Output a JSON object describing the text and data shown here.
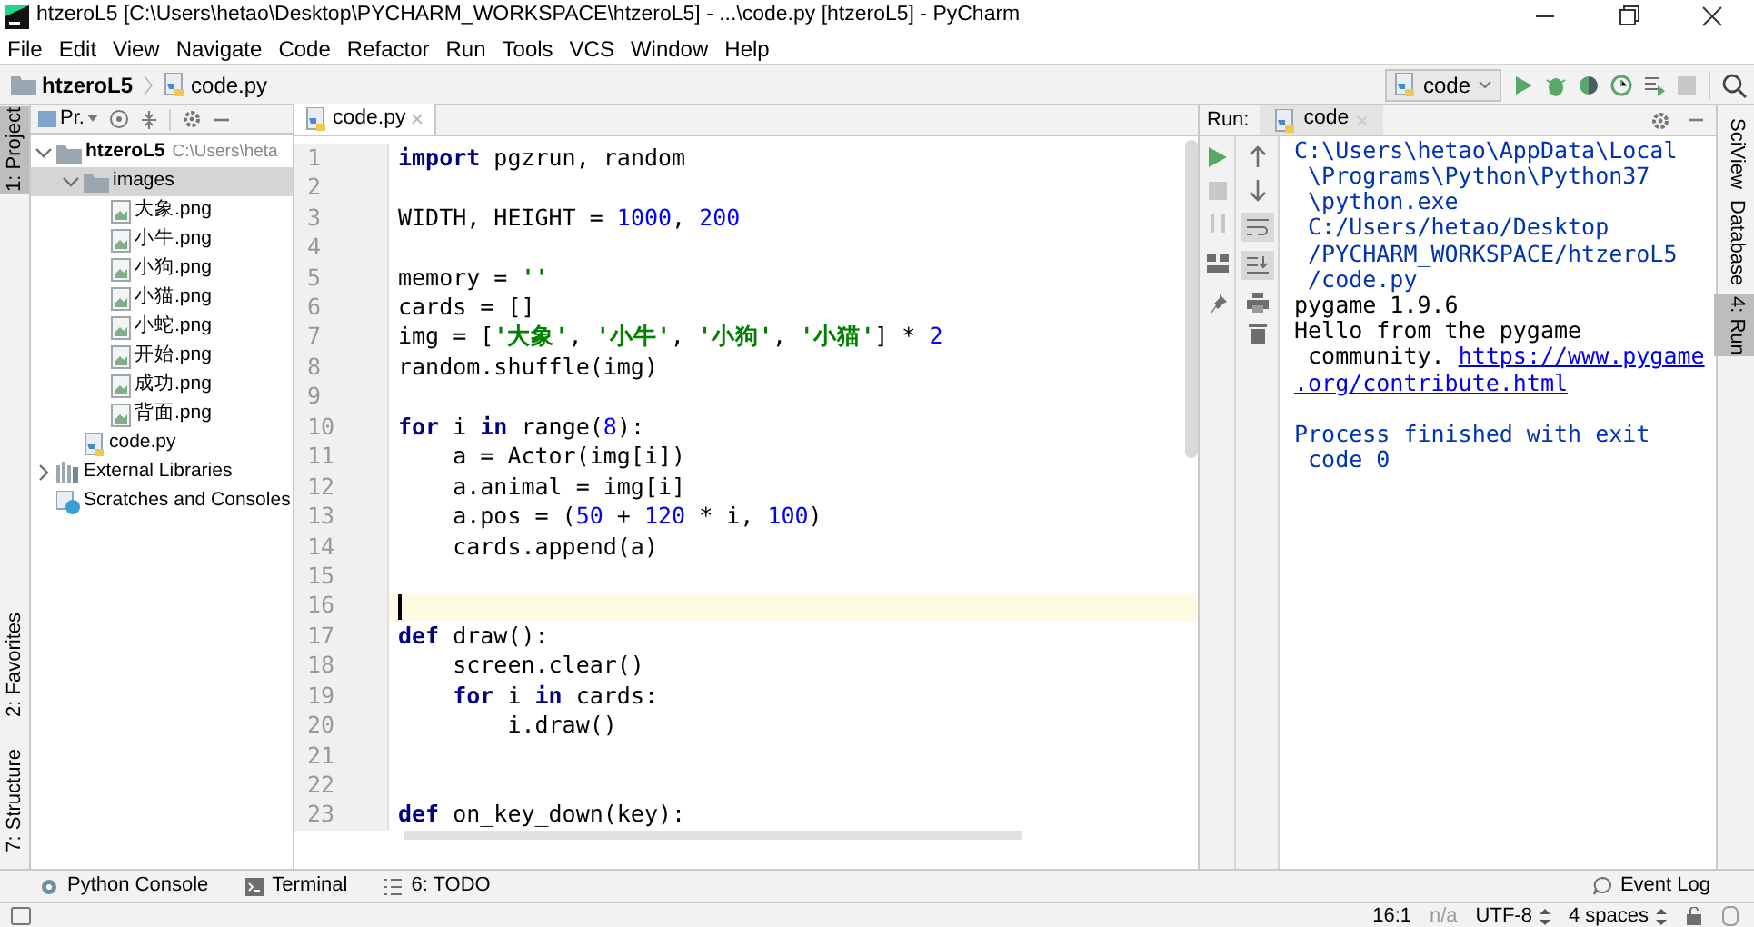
{
  "window": {
    "title": "htzeroL5 [C:\\Users\\hetao\\Desktop\\PYCHARM_WORKSPACE\\htzeroL5] - ...\\code.py [htzeroL5] - PyCharm"
  },
  "menu": [
    "File",
    "Edit",
    "View",
    "Navigate",
    "Code",
    "Refactor",
    "Run",
    "Tools",
    "VCS",
    "Window",
    "Help"
  ],
  "breadcrumb": [
    {
      "label": "htzeroL5",
      "kind": "folder"
    },
    {
      "label": "code.py",
      "kind": "python"
    }
  ],
  "run_config": {
    "label": "code"
  },
  "left_stripe": [
    {
      "label": "1: Project",
      "selected": true
    },
    {
      "label": "2: Favorites",
      "selected": false
    },
    {
      "label": "7: Structure",
      "selected": false
    }
  ],
  "right_stripe": [
    {
      "label": "SciView",
      "selected": false
    },
    {
      "label": "Database",
      "selected": false
    },
    {
      "label": "4: Run",
      "selected": true
    }
  ],
  "project": {
    "title": "Pr.",
    "tree": [
      {
        "label": "htzeroL5",
        "hint": "C:\\Users\\heta",
        "kind": "folder",
        "expanded": true,
        "selected": false,
        "children": [
          {
            "label": "images",
            "kind": "folder",
            "expanded": true,
            "selected": true,
            "children": [
              {
                "label": "大象.png",
                "kind": "image",
                "selected": false
              },
              {
                "label": "小牛.png",
                "kind": "image",
                "selected": false
              },
              {
                "label": "小狗.png",
                "kind": "image",
                "selected": false
              },
              {
                "label": "小猫.png",
                "kind": "image",
                "selected": false
              },
              {
                "label": "小蛇.png",
                "kind": "image",
                "selected": false
              },
              {
                "label": "开始.png",
                "kind": "image",
                "selected": false
              },
              {
                "label": "成功.png",
                "kind": "image",
                "selected": false
              },
              {
                "label": "背面.png",
                "kind": "image",
                "selected": false
              }
            ]
          },
          {
            "label": "code.py",
            "kind": "python",
            "selected": false
          }
        ]
      },
      {
        "label": "External Libraries",
        "kind": "library",
        "expanded": false,
        "selected": false
      },
      {
        "label": "Scratches and Consoles",
        "kind": "scratch",
        "selected": false
      }
    ]
  },
  "editor": {
    "tabs": [
      {
        "label": "code.py",
        "selected": true
      }
    ],
    "lines": [
      {
        "number": "1",
        "current": false,
        "tokens": [
          {
            "text": "import",
            "kind": "kw"
          },
          {
            "text": " pgzrun, random",
            "kind": "plain"
          }
        ]
      },
      {
        "number": "2",
        "current": false
      },
      {
        "number": "3",
        "current": false,
        "tokens": [
          {
            "text": "WIDTH, HEIGHT = ",
            "kind": "plain"
          },
          {
            "text": "1000",
            "kind": "num"
          },
          {
            "text": ", ",
            "kind": "plain"
          },
          {
            "text": "200",
            "kind": "num"
          }
        ]
      },
      {
        "number": "4",
        "current": false
      },
      {
        "number": "5",
        "current": false,
        "tokens": [
          {
            "text": "memory = ",
            "kind": "plain"
          },
          {
            "text": "''",
            "kind": "str"
          }
        ]
      },
      {
        "number": "6",
        "current": false,
        "tokens": [
          {
            "text": "cards = []",
            "kind": "plain"
          }
        ]
      },
      {
        "number": "7",
        "current": false,
        "tokens": [
          {
            "text": "img = [",
            "kind": "plain"
          },
          {
            "text": "'大象'",
            "kind": "str"
          },
          {
            "text": ", ",
            "kind": "plain"
          },
          {
            "text": "'小牛'",
            "kind": "str"
          },
          {
            "text": ", ",
            "kind": "plain"
          },
          {
            "text": "'小狗'",
            "kind": "str"
          },
          {
            "text": ", ",
            "kind": "plain"
          },
          {
            "text": "'小猫'",
            "kind": "str"
          },
          {
            "text": "] * ",
            "kind": "plain"
          },
          {
            "text": "2",
            "kind": "num"
          }
        ]
      },
      {
        "number": "8",
        "current": false,
        "tokens": [
          {
            "text": "random.shuffle(img)",
            "kind": "plain"
          }
        ]
      },
      {
        "number": "9",
        "current": false
      },
      {
        "number": "10",
        "current": false,
        "tokens": [
          {
            "text": "for",
            "kind": "kw"
          },
          {
            "text": " i ",
            "kind": "plain"
          },
          {
            "text": "in",
            "kind": "kw"
          },
          {
            "text": " range(",
            "kind": "plain"
          },
          {
            "text": "8",
            "kind": "num"
          },
          {
            "text": "):",
            "kind": "plain"
          }
        ]
      },
      {
        "number": "11",
        "current": false,
        "tokens": [
          {
            "text": "    a = Actor(img[i])",
            "kind": "plain"
          }
        ]
      },
      {
        "number": "12",
        "current": false,
        "tokens": [
          {
            "text": "    a.animal = img[i]",
            "kind": "plain"
          }
        ]
      },
      {
        "number": "13",
        "current": false,
        "tokens": [
          {
            "text": "    a.pos = (",
            "kind": "plain"
          },
          {
            "text": "50",
            "kind": "num"
          },
          {
            "text": " + ",
            "kind": "plain"
          },
          {
            "text": "120",
            "kind": "num"
          },
          {
            "text": " * i, ",
            "kind": "plain"
          },
          {
            "text": "100",
            "kind": "num"
          },
          {
            "text": ")",
            "kind": "plain"
          }
        ]
      },
      {
        "number": "14",
        "current": false,
        "tokens": [
          {
            "text": "    cards.append(a)",
            "kind": "plain"
          }
        ]
      },
      {
        "number": "15",
        "current": false
      },
      {
        "number": "16",
        "current": true
      },
      {
        "number": "17",
        "current": false,
        "tokens": [
          {
            "text": "def",
            "kind": "kw"
          },
          {
            "text": " draw():",
            "kind": "plain"
          }
        ]
      },
      {
        "number": "18",
        "current": false,
        "tokens": [
          {
            "text": "    screen.clear()",
            "kind": "plain"
          }
        ]
      },
      {
        "number": "19",
        "current": false,
        "tokens": [
          {
            "text": "    for",
            "kind": "kw"
          },
          {
            "text": " i ",
            "kind": "plain"
          },
          {
            "text": "in",
            "kind": "kw"
          },
          {
            "text": " cards:",
            "kind": "plain"
          }
        ]
      },
      {
        "number": "20",
        "current": false,
        "tokens": [
          {
            "text": "        i.draw()",
            "kind": "plain"
          }
        ]
      },
      {
        "number": "21",
        "current": false
      },
      {
        "number": "22",
        "current": false
      },
      {
        "number": "23",
        "current": false,
        "tokens": [
          {
            "text": "def",
            "kind": "kw"
          },
          {
            "text": " on_key_down(key):",
            "kind": "plain"
          }
        ]
      }
    ]
  },
  "run": {
    "label": "Run:",
    "tab": "code",
    "output": [
      {
        "lines": [
          [
            {
              "text": "C:\\Users\\hetao\\AppData\\Local",
              "kind": "system"
            }
          ],
          [
            {
              "text": " \\Programs\\Python\\Python37",
              "kind": "system"
            }
          ],
          [
            {
              "text": " \\python.exe",
              "kind": "system"
            }
          ],
          [
            {
              "text": " C:/Users/hetao/Desktop",
              "kind": "system"
            }
          ],
          [
            {
              "text": " /PYCHARM_WORKSPACE/htzeroL5",
              "kind": "system"
            }
          ],
          [
            {
              "text": " /code.py",
              "kind": "system"
            }
          ],
          [
            {
              "text": "pygame 1.9.6",
              "kind": "stdout"
            }
          ],
          [
            {
              "text": "Hello from the pygame",
              "kind": "stdout"
            }
          ],
          [
            {
              "text": " community. ",
              "kind": "stdout"
            },
            {
              "text": "https://www.pygame",
              "kind": "link"
            }
          ],
          [
            {
              "text": " .org/contribute.html",
              "kind": "link"
            }
          ]
        ]
      },
      {
        "lines": [
          [
            {
              "text": "Process finished with exit",
              "kind": "system"
            }
          ],
          [
            {
              "text": " code 0",
              "kind": "system"
            }
          ]
        ]
      }
    ]
  },
  "bottom_tools": [
    {
      "label": "Python Console",
      "kind": "console"
    },
    {
      "label": "Terminal",
      "kind": "terminal"
    },
    {
      "label": "6: TODO",
      "kind": "todo"
    }
  ],
  "event_log": "Event Log",
  "status": [
    {
      "text": "16:1",
      "kind": "plain"
    },
    {
      "text": "n/a",
      "kind": "muted"
    },
    {
      "text": "UTF-8",
      "kind": "choice"
    },
    {
      "text": "4 spaces",
      "kind": "choice"
    }
  ]
}
